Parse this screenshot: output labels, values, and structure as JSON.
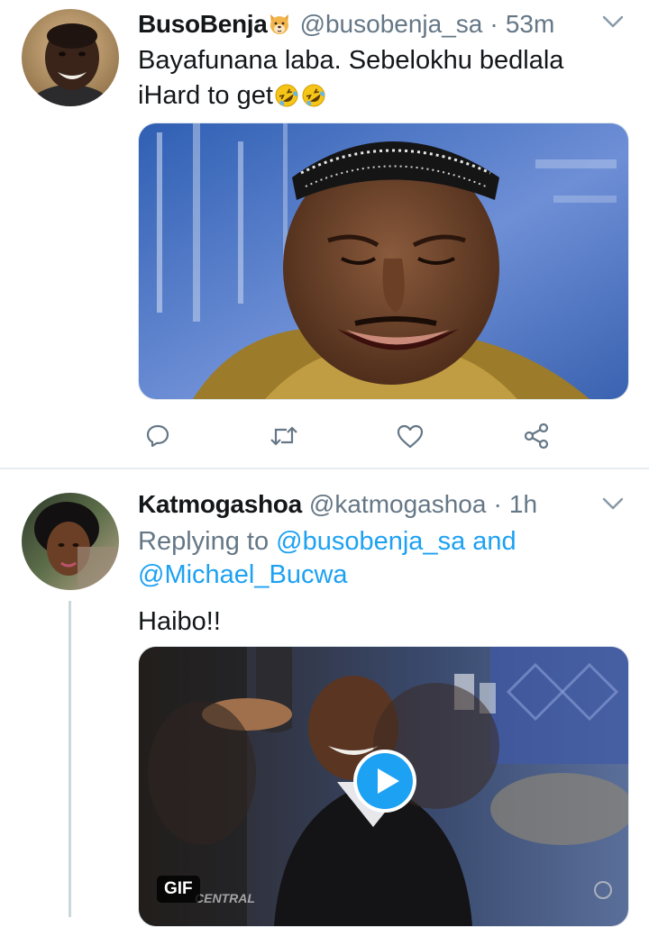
{
  "tweets": [
    {
      "name": "BusoBenja",
      "name_emoji": "dog-face-emoji",
      "handle": "@busobenja_sa",
      "separator": "·",
      "time": "53m",
      "text_line1": "Bayafunana laba. Sebelokhu bedlala",
      "text_line2": "iHard to get",
      "text_emojis": [
        "rolling-on-floor-laughing-emoji",
        "rolling-on-floor-laughing-emoji"
      ],
      "media_type": "photo",
      "actions": [
        "reply-icon",
        "retweet-icon",
        "like-icon",
        "share-icon"
      ]
    },
    {
      "name": "Katmogashoa",
      "handle": "@katmogashoa",
      "separator": "·",
      "time": "1h",
      "replying_prefix": "Replying to",
      "reply_mention1": "@busobenja_sa",
      "reply_and": "and",
      "reply_mention2": "@Michael_Bucwa",
      "text": "Haibo!!",
      "media_type": "gif",
      "gif_label": "GIF",
      "watermark": "CENTRAL"
    }
  ],
  "colors": {
    "primary_text": "#14171a",
    "secondary_text": "#657786",
    "link": "#1da1f2",
    "border": "#e6ecf0",
    "play_button": "#1da1f2"
  }
}
